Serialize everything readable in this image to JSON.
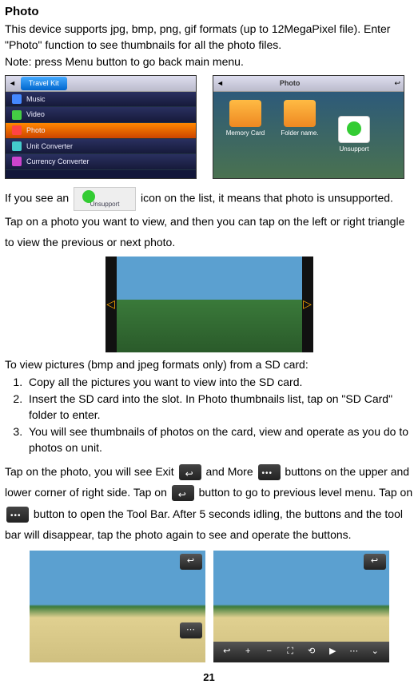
{
  "heading": "Photo",
  "intro1": "This device supports jpg, bmp, png, gif formats (up to 12MegaPixel file). Enter \"Photo\" function to see thumbnails for all the photo files.",
  "intro2": "Note: press Menu button to go back main menu.",
  "shot1": {
    "tab": "Travel Kit",
    "items": [
      "Music",
      "Video",
      "Photo",
      "Unit Converter",
      "Currency Converter"
    ]
  },
  "shot2": {
    "title": "Photo",
    "thumbs": [
      "Memory Card",
      "Folder name.",
      "Unsupport"
    ]
  },
  "unsupport_label": "Unsupport",
  "para_unsupport_a": "If you see an ",
  "para_unsupport_b": " icon on the list, it means that photo is unsupported. Tap on a photo you want to view, and then you can tap on the left or right triangle to view the previous or next photo.",
  "sd_intro": "To view pictures (bmp and jpeg formats only) from a SD card:",
  "steps": [
    "Copy all the pictures you want to view into the SD card.",
    "Insert the SD card into the slot. In Photo thumbnails list, tap on \"SD Card\" folder to enter.",
    "You will see thumbnails of photos on the card, view and operate as you do to photos on unit."
  ],
  "exit_a": "Tap on the photo, you will see Exit ",
  "exit_b": " and More ",
  "exit_c": " buttons on the upper and lower corner of right side. Tap on ",
  "exit_d": " button to go to previous level menu. Tap on ",
  "exit_e": " button to open the Tool Bar. After 5 seconds idling, the buttons and the tool bar will disappear, tap the photo again to see and operate the buttons.",
  "bottom_toolbar": [
    "↩",
    "+",
    "−",
    "⛶",
    "⟲",
    "▶",
    "⋯",
    "⌄"
  ],
  "page_number": "21"
}
